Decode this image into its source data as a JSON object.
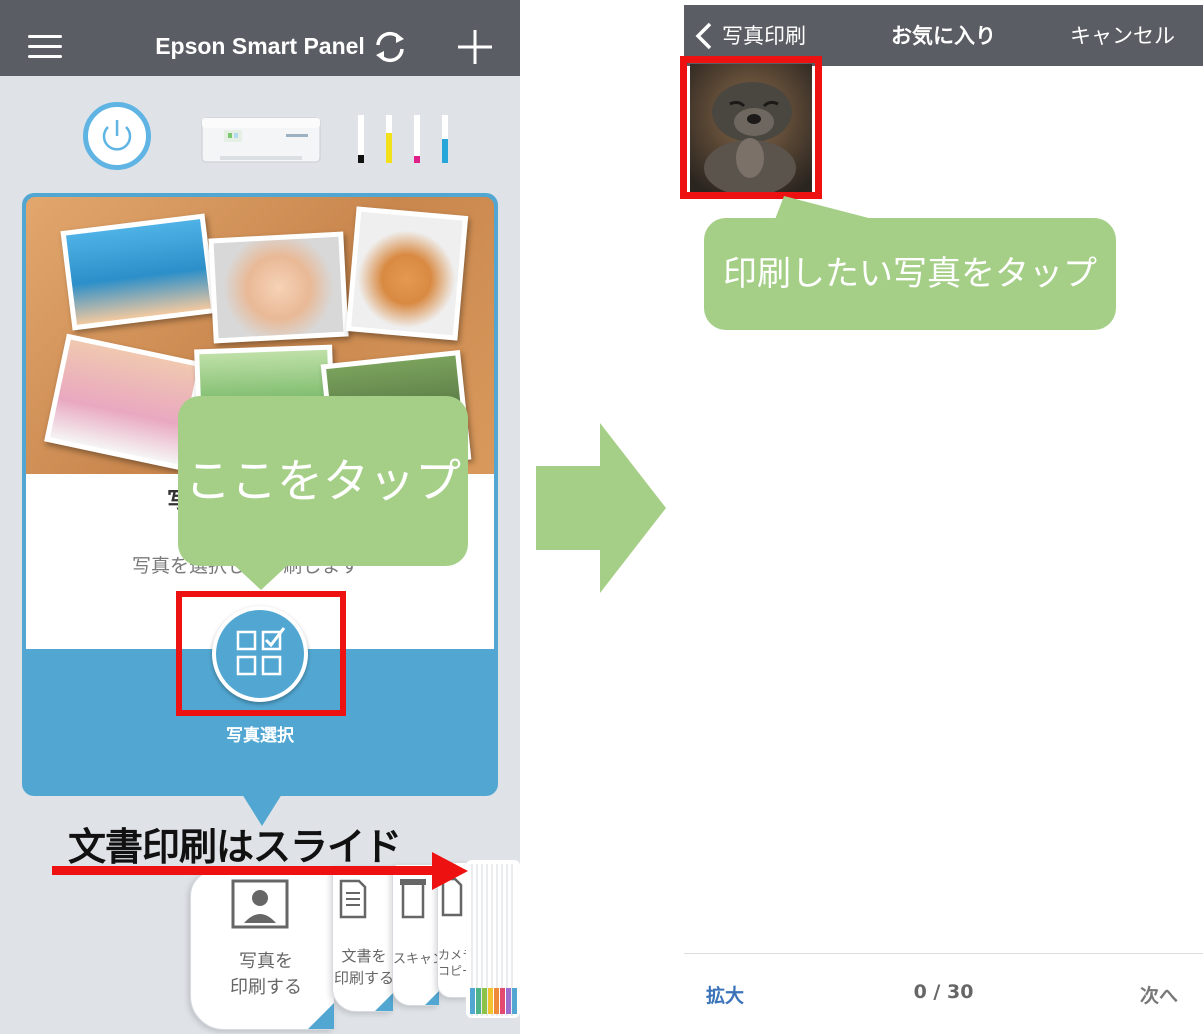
{
  "left_app": {
    "title": "Epson Smart Panel",
    "icons": [
      "menu-icon",
      "sync-icon",
      "plus-icon",
      "power-icon",
      "printer-image",
      "ink-level-icon",
      "photo-select-icon"
    ],
    "card": {
      "title_partial": "写",
      "description": "写真を選択して印刷します",
      "button_label": "写真選択"
    },
    "tabs": [
      {
        "label": "写真を\n印刷する"
      },
      {
        "label": "文書を\n印刷する"
      },
      {
        "label": "スキャンする"
      },
      {
        "label": "カメラ\nコピー"
      }
    ]
  },
  "annotations": {
    "tap_here": "ここをタップ",
    "slide_hint": "文書印刷はスライド",
    "tap_photo": "印刷したい写真をタップ"
  },
  "right_app": {
    "back_label": "写真印刷",
    "title": "お気に入り",
    "cancel_label": "キャンセル",
    "zoom_label": "拡大",
    "counter": "0 / 30",
    "next_label": "次へ"
  },
  "colors": {
    "header": "#5a5d63",
    "accent_blue": "#52a7d2",
    "annotation_green": "#a5cf87",
    "highlight_red": "#ee1111",
    "link_blue": "#3b73b9"
  }
}
